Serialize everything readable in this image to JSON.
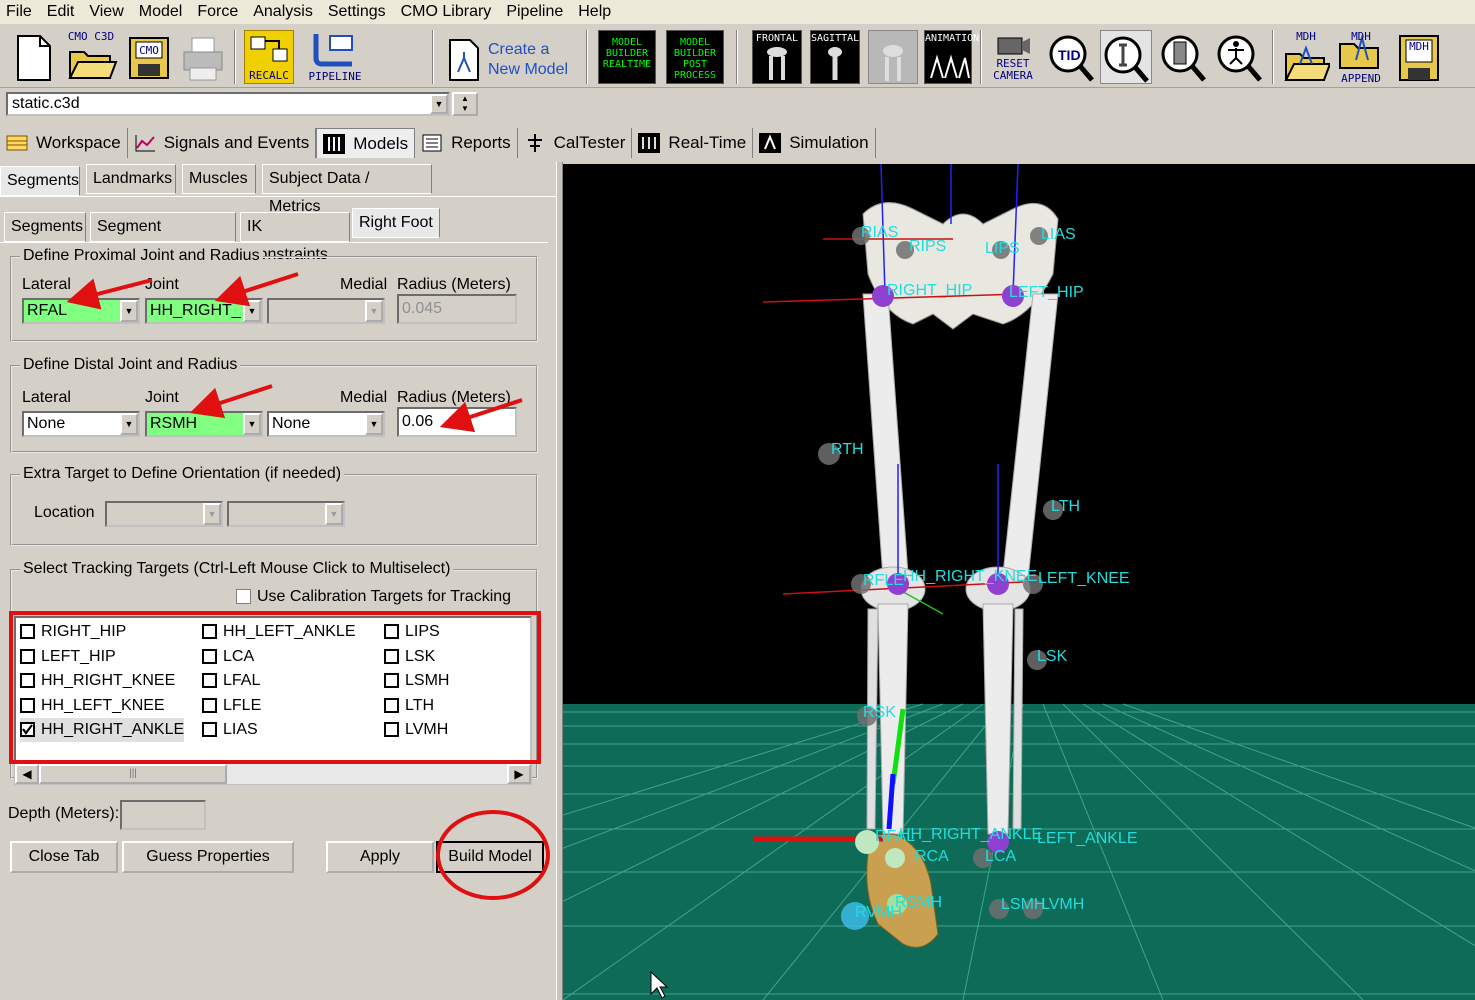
{
  "menu": [
    "File",
    "Edit",
    "View",
    "Model",
    "Force",
    "Analysis",
    "Settings",
    "CMO Library",
    "Pipeline",
    "Help"
  ],
  "toolbar": {
    "cmo_c3d": "CMO C3D",
    "cmo": "CMO",
    "recalc": "RECALC",
    "pipeline": "PIPELINE",
    "create_model_line1": "Create a",
    "create_model_line2": "New Model",
    "mb_realtime": "MODEL BUILDER REALTIME",
    "mb_post": "MODEL BUILDER POST PROCESS",
    "frontal": "FRONTAL",
    "sagittal": "SAGITTAL",
    "animation": "ANIMATION",
    "reset_camera_1": "RESET",
    "reset_camera_2": "CAMERA",
    "tid": "TID",
    "mdh": "MDH",
    "mdh_append": "APPEND"
  },
  "file_combo": "static.c3d",
  "main_tabs": [
    "Workspace",
    "Signals and Events",
    "Models",
    "Reports",
    "CalTester",
    "Real-Time",
    "Simulation"
  ],
  "active_main_tab": "Models",
  "sub_tabs_1": [
    "Segments",
    "Landmarks",
    "Muscles",
    "Subject Data / Metrics"
  ],
  "sub_tabs_2": [
    "Segments",
    "Segment Properties",
    "IK Constraints",
    "Right Foot"
  ],
  "proximal": {
    "title": "Define Proximal Joint and Radius",
    "lateral_label": "Lateral",
    "joint_label": "Joint",
    "medial_label": "Medial",
    "radius_label": "Radius (Meters)",
    "lateral_value": "RFAL",
    "joint_value": "HH_RIGHT_",
    "medial_value": "",
    "radius_value": "0.045"
  },
  "distal": {
    "title": "Define Distal Joint and Radius",
    "lateral_label": "Lateral",
    "joint_label": "Joint",
    "medial_label": "Medial",
    "radius_label": "Radius (Meters)",
    "lateral_value": "None",
    "joint_value": "RSMH",
    "medial_value": "None",
    "radius_value": "0.06"
  },
  "extra": {
    "title": "Extra Target to Define Orientation (if needed)",
    "location_label": "Location"
  },
  "tracking": {
    "title": "Select Tracking Targets (Ctrl-Left Mouse Click to Multiselect)",
    "calibration_label": "Use Calibration Targets for Tracking",
    "targets": [
      {
        "label": "RIGHT_HIP",
        "checked": false
      },
      {
        "label": "LEFT_HIP",
        "checked": false
      },
      {
        "label": "HH_RIGHT_KNEE",
        "checked": false
      },
      {
        "label": "HH_LEFT_KNEE",
        "checked": false
      },
      {
        "label": "HH_RIGHT_ANKLE",
        "checked": true
      },
      {
        "label": "HH_LEFT_ANKLE",
        "checked": false
      },
      {
        "label": "LCA",
        "checked": false
      },
      {
        "label": "LFAL",
        "checked": false
      },
      {
        "label": "LFLE",
        "checked": false
      },
      {
        "label": "LIAS",
        "checked": false
      },
      {
        "label": "LIPS",
        "checked": false
      },
      {
        "label": "LSK",
        "checked": false
      },
      {
        "label": "LSMH",
        "checked": false
      },
      {
        "label": "LTH",
        "checked": false
      },
      {
        "label": "LVMH",
        "checked": false
      }
    ]
  },
  "depth_label": "Depth (Meters):",
  "buttons": {
    "close_tab": "Close Tab",
    "guess_properties": "Guess Properties",
    "apply": "Apply",
    "build_model": "Build Model"
  },
  "viewport_labels": [
    "RIAS",
    "RIPS",
    "LIPS",
    "LIAS",
    "RIGHT_HIP",
    "LEFT_HIP",
    "RTH",
    "LTH",
    "RFLE",
    "HH_RIGHT_KNEE",
    "LEFT_KNEE",
    "LSK",
    "RSK",
    "RFAL",
    "HH_RIGHT_ANKLE",
    "LEFT_ANKLE",
    "RCA",
    "LCA",
    "RVMH",
    "RSMH",
    "LSMH",
    "LVMH"
  ],
  "colors": {
    "highlight_green": "#80ff80",
    "annotation_red": "#e01010",
    "landmark_cyan": "#22dddd",
    "floor_green": "#0d6b57"
  }
}
